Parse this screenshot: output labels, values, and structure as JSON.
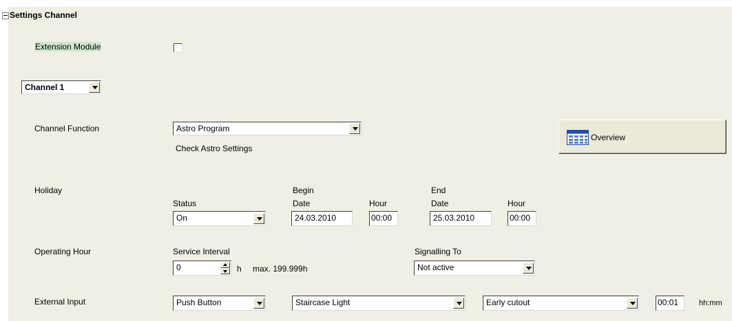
{
  "section": {
    "title": "Settings Channel"
  },
  "extension_module": {
    "label": "Extension Module",
    "checked": false
  },
  "channel_select": {
    "value": "Channel 1"
  },
  "channel_function": {
    "label": "Channel Function",
    "value": "Astro Program",
    "note": "Check Astro Settings"
  },
  "overview_button": {
    "label": "Overview"
  },
  "holiday": {
    "label": "Holiday",
    "status_label": "Status",
    "status_value": "On",
    "begin_label": "Begin",
    "begin_date_label": "Date",
    "begin_date": "24.03.2010",
    "begin_hour_label": "Hour",
    "begin_hour": "00:00",
    "end_label": "End",
    "end_date_label": "Date",
    "end_date": "25.03.2010",
    "end_hour_label": "Hour",
    "end_hour": "00:00"
  },
  "operating_hour": {
    "label": "Operating Hour",
    "service_interval_label": "Service Interval",
    "service_interval_value": "0",
    "unit": "h",
    "max_text": "max. 199.999h",
    "signalling_label": "Signalling To",
    "signalling_value": "Not active"
  },
  "external_input": {
    "label": "External Input",
    "type_value": "Push Button",
    "function_value": "Staircase Light",
    "mode_value": "Early cutout",
    "time_value": "00:01",
    "time_unit": "hh:mm"
  }
}
